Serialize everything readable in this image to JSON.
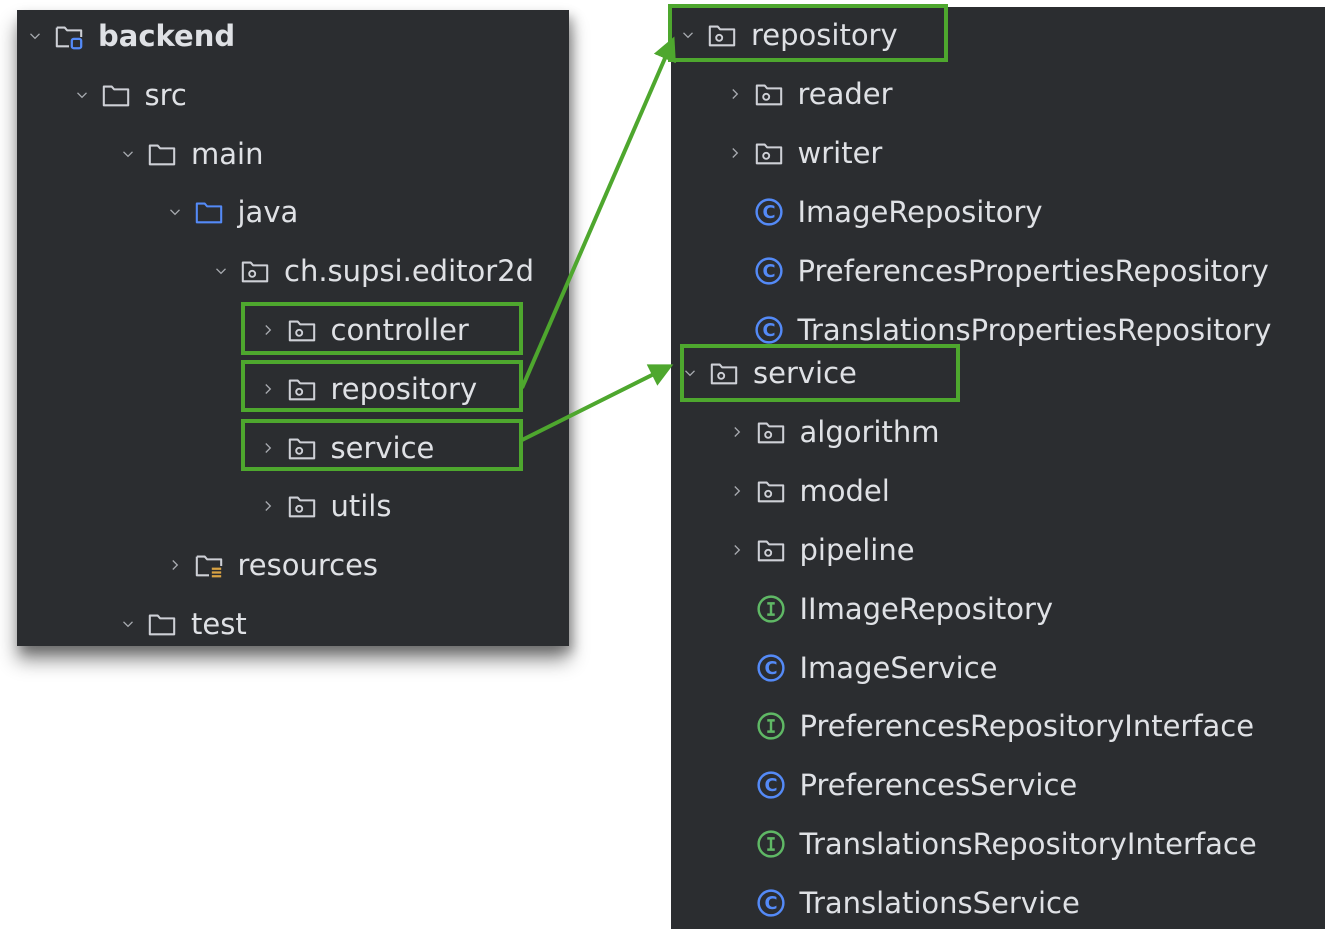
{
  "left_tree": {
    "items": [
      {
        "label": "backend",
        "bold": true,
        "icon": "module-folder-icon",
        "chevron": "expanded"
      },
      {
        "label": "src",
        "icon": "folder-icon",
        "chevron": "expanded"
      },
      {
        "label": "main",
        "icon": "folder-icon",
        "chevron": "expanded"
      },
      {
        "label": "java",
        "icon": "source-folder-icon",
        "chevron": "expanded"
      },
      {
        "label": "ch.supsi.editor2d",
        "icon": "package-icon",
        "chevron": "expanded"
      },
      {
        "label": "controller",
        "icon": "package-icon",
        "chevron": "collapsed",
        "highlighted": true
      },
      {
        "label": "repository",
        "icon": "package-icon",
        "chevron": "collapsed",
        "highlighted": true
      },
      {
        "label": "service",
        "icon": "package-icon",
        "chevron": "collapsed",
        "highlighted": true
      },
      {
        "label": "utils",
        "icon": "package-icon",
        "chevron": "collapsed"
      },
      {
        "label": "resources",
        "icon": "resources-folder-icon",
        "chevron": "collapsed"
      },
      {
        "label": "test",
        "icon": "folder-icon",
        "chevron": "expanded"
      }
    ]
  },
  "right_tree": {
    "items": [
      {
        "label": "repository",
        "icon": "package-icon",
        "chevron": "expanded",
        "highlighted": true
      },
      {
        "label": "reader",
        "icon": "package-icon",
        "chevron": "collapsed"
      },
      {
        "label": "writer",
        "icon": "package-icon",
        "chevron": "collapsed"
      },
      {
        "label": "ImageRepository",
        "icon": "class-icon"
      },
      {
        "label": "PreferencesPropertiesRepository",
        "icon": "class-icon"
      },
      {
        "label": "TranslationsPropertiesRepository",
        "icon": "class-icon"
      },
      {
        "label": "service",
        "icon": "package-icon",
        "chevron": "expanded",
        "highlighted": true
      },
      {
        "label": "algorithm",
        "icon": "package-icon",
        "chevron": "collapsed"
      },
      {
        "label": "model",
        "icon": "package-icon",
        "chevron": "collapsed"
      },
      {
        "label": "pipeline",
        "icon": "package-icon",
        "chevron": "collapsed"
      },
      {
        "label": "IImageRepository",
        "icon": "interface-icon"
      },
      {
        "label": "ImageService",
        "icon": "class-icon"
      },
      {
        "label": "PreferencesRepositoryInterface",
        "icon": "interface-icon"
      },
      {
        "label": "PreferencesService",
        "icon": "class-icon"
      },
      {
        "label": "TranslationsRepositoryInterface",
        "icon": "interface-icon"
      },
      {
        "label": "TranslationsService",
        "icon": "class-icon"
      }
    ]
  },
  "colors": {
    "panel_background": "#2b2d30",
    "text": "#dfe1e5",
    "icon_gray": "#ced0d6",
    "source_folder_blue": "#548af7",
    "class_blue": "#548af7",
    "interface_green": "#5fb865",
    "resources_yellow": "#d9a343",
    "highlight_green": "#4ea72e"
  }
}
